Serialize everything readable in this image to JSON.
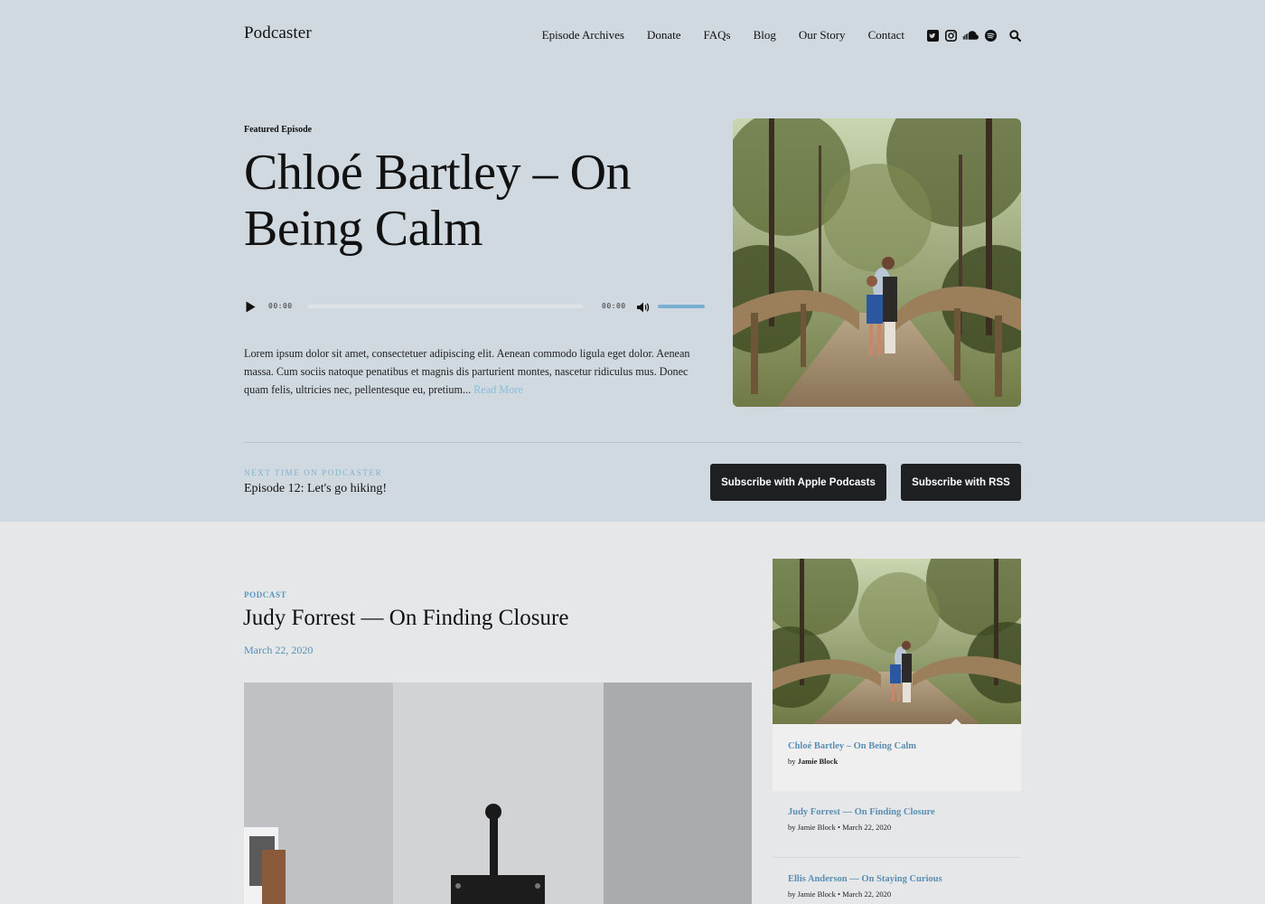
{
  "site": {
    "logo": "Podcaster"
  },
  "nav": {
    "items": [
      "Episode Archives",
      "Donate",
      "FAQs",
      "Blog",
      "Our Story",
      "Contact"
    ],
    "social_icons": [
      "twitter-icon",
      "instagram-icon",
      "soundcloud-icon",
      "spotify-icon"
    ],
    "search_icon": "search-icon"
  },
  "featured": {
    "label": "Featured Episode",
    "title": "Chloé Bartley – On Being Calm",
    "player": {
      "current_time": "00:00",
      "duration": "00:00",
      "progress": 0,
      "volume": 1.0
    },
    "excerpt": "Lorem ipsum dolor sit amet, consectetuer adipiscing elit. Aenean commodo ligula eget dolor. Aenean massa. Cum sociis natoque penatibus et magnis dis parturient montes, nascetur ridiculus mus. Donec quam felis, ultricies nec, pellentesque eu, pretium...",
    "read_more": "Read More"
  },
  "next_time": {
    "label": "NEXT TIME ON PODCASTER",
    "title": "Episode 12: Let's go hiking!"
  },
  "subscribe": {
    "apple": "Subscribe with Apple Podcasts",
    "rss": "Subscribe with RSS"
  },
  "post": {
    "category": "PODCAST",
    "title": "Judy Forrest — On Finding Closure",
    "date": "March 22, 2020"
  },
  "sidebar": {
    "featured_card": {
      "title": "Chloé Bartley – On Being Calm",
      "by": "by",
      "author": "Jamie Block"
    },
    "items": [
      {
        "title": "Judy Forrest — On Finding Closure",
        "meta": "by Jamie Block • March 22, 2020"
      },
      {
        "title": "Ellis Anderson — On Staying Curious",
        "meta": "by Jamie Block • March 22, 2020"
      }
    ]
  },
  "colors": {
    "hero_bg": "#d0d9df",
    "page_bg": "#e5e7e9",
    "accent": "#5b8fb2",
    "button": "#1f2021"
  }
}
